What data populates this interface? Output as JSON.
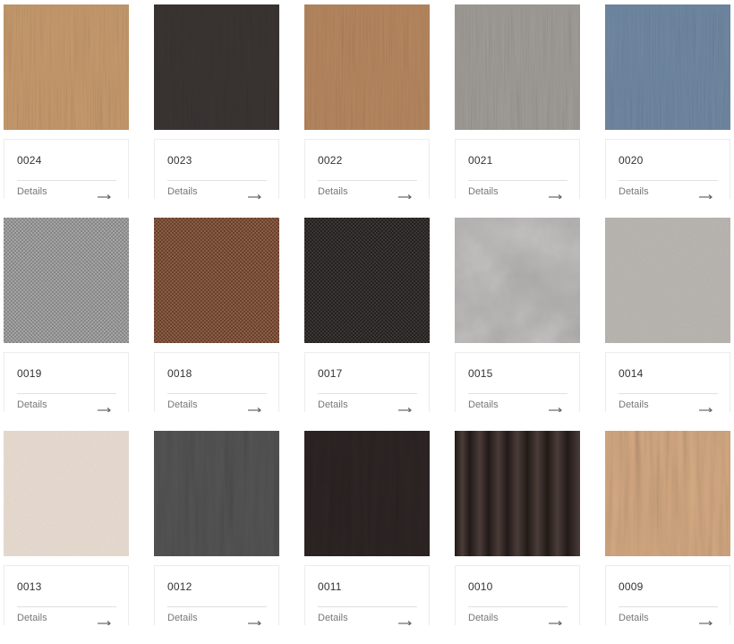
{
  "details_label": "Details",
  "items": [
    {
      "code": "0024",
      "texture": "vertical-grain",
      "color": "#c79b6d",
      "tint": "#a97e52"
    },
    {
      "code": "0023",
      "texture": "vertical-grain",
      "color": "#3a3432",
      "tint": "#24201f"
    },
    {
      "code": "0022",
      "texture": "vertical-grain",
      "color": "#b78860",
      "tint": "#9b6f48"
    },
    {
      "code": "0021",
      "texture": "vertical-grain",
      "color": "#a19d98",
      "tint": "#858079"
    },
    {
      "code": "0020",
      "texture": "vertical-grain",
      "color": "#7189a4",
      "tint": "#5a7089"
    },
    {
      "code": "0019",
      "texture": "woven-fabric",
      "color": "#a9a9a9",
      "tint": "#8b8b8b"
    },
    {
      "code": "0018",
      "texture": "woven-fabric",
      "color": "#8f5f45",
      "tint": "#6c4330"
    },
    {
      "code": "0017",
      "texture": "woven-fabric",
      "color": "#3b3835",
      "tint": "#252321"
    },
    {
      "code": "0015",
      "texture": "cloudy-concrete",
      "color": "#a9a7a6",
      "tint": "#7e7b7a"
    },
    {
      "code": "0014",
      "texture": "speckled-stone",
      "color": "#bdbab5",
      "tint": "#9d9a95"
    },
    {
      "code": "0013",
      "texture": "speckled-stone",
      "color": "#ede0d5",
      "tint": "#d8c8bb"
    },
    {
      "code": "0012",
      "texture": "wood-grain",
      "color": "#555454",
      "tint": "#3a3a3a"
    },
    {
      "code": "0011",
      "texture": "wood-grain",
      "color": "#2d2524",
      "tint": "#1a1414"
    },
    {
      "code": "0010",
      "texture": "vertical-stripes",
      "color": "#4a3c38",
      "tint": "#221a18"
    },
    {
      "code": "0009",
      "texture": "wood-grain",
      "color": "#d6ab83",
      "tint": "#bd8f66"
    }
  ]
}
